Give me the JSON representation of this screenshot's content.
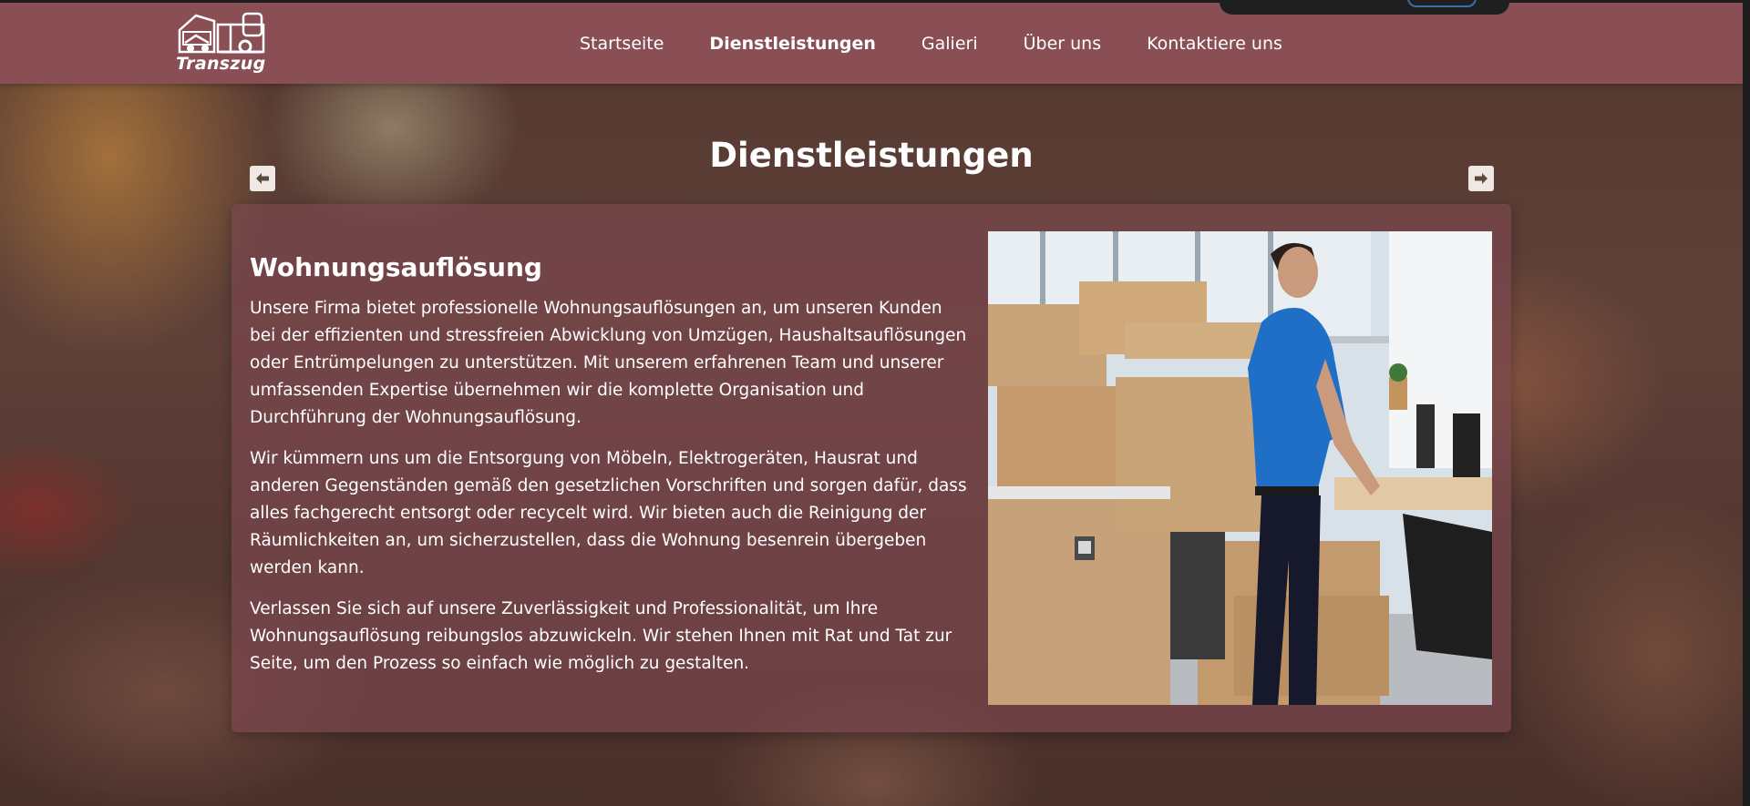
{
  "brand": {
    "logo_text": "Transzug",
    "logo_icon": "moving-truck-icon"
  },
  "nav": {
    "items": [
      {
        "label": "Startseite",
        "active": false
      },
      {
        "label": "Dienstleistungen",
        "active": true
      },
      {
        "label": "Galieri",
        "active": false
      },
      {
        "label": "Über uns",
        "active": false
      },
      {
        "label": "Kontaktiere uns",
        "active": false
      }
    ]
  },
  "section": {
    "title": "Dienstleistungen",
    "prev_icon": "arrow-left-icon",
    "next_icon": "arrow-right-icon"
  },
  "service": {
    "title": "Wohnungsauflösung",
    "paragraphs": [
      "Unsere Firma bietet professionelle Wohnungsauflösungen an, um unseren Kunden bei der effizienten und stressfreien Abwicklung von Umzügen, Haushaltsauflösungen oder Entrümpelungen zu unterstützen. Mit unserem erfahrenen Team und unserer umfassenden Expertise übernehmen wir die komplette Organisation und Durchführung der Wohnungsauflösung.",
      "Wir kümmern uns um die Entsorgung von Möbeln, Elektrogeräten, Hausrat und anderen Gegenständen gemäß den gesetzlichen Vorschriften und sorgen dafür, dass alles fachgerecht entsorgt oder recycelt wird. Wir bieten auch die Reinigung der Räumlichkeiten an, um sicherzustellen, dass die Wohnung besenrein übergeben werden kann.",
      "Verlassen Sie sich auf unsere Zuverlässigkeit und Professionalität, um Ihre Wohnungsauflösung reibungslos abzuwickeln. Wir stehen Ihnen mit Rat und Tat zur Seite, um den Prozess so einfach wie möglich zu gestalten."
    ]
  },
  "colors": {
    "navbar": "#8a4f55",
    "card": "#7a464e",
    "text": "#ffffff"
  }
}
